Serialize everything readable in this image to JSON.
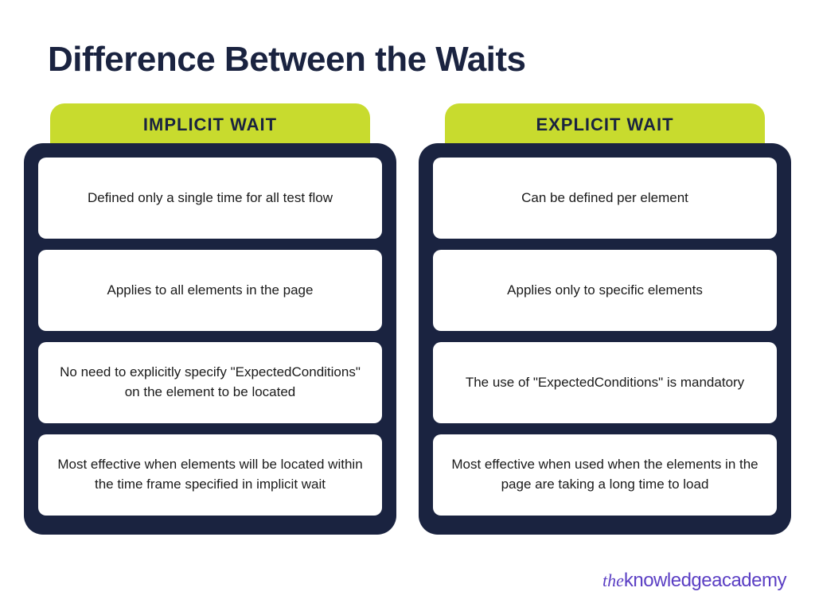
{
  "title": "Difference Between the Waits",
  "columns": [
    {
      "header": "IMPLICIT WAIT",
      "items": [
        "Defined only a single time for all test flow",
        "Applies to all elements in the page",
        "No need to explicitly specify \"ExpectedConditions\" on the element to be located",
        "Most effective when elements will be located within the time frame specified in implicit wait"
      ]
    },
    {
      "header": "EXPLICIT WAIT",
      "items": [
        "Can be defined per element",
        "Applies only to specific elements",
        "The use of \"ExpectedConditions\" is mandatory",
        "Most effective when used when the elements in the page are taking a long time to load"
      ]
    }
  ],
  "attribution": {
    "the": "the",
    "knowledge": "knowledge",
    "academy": "academy"
  }
}
